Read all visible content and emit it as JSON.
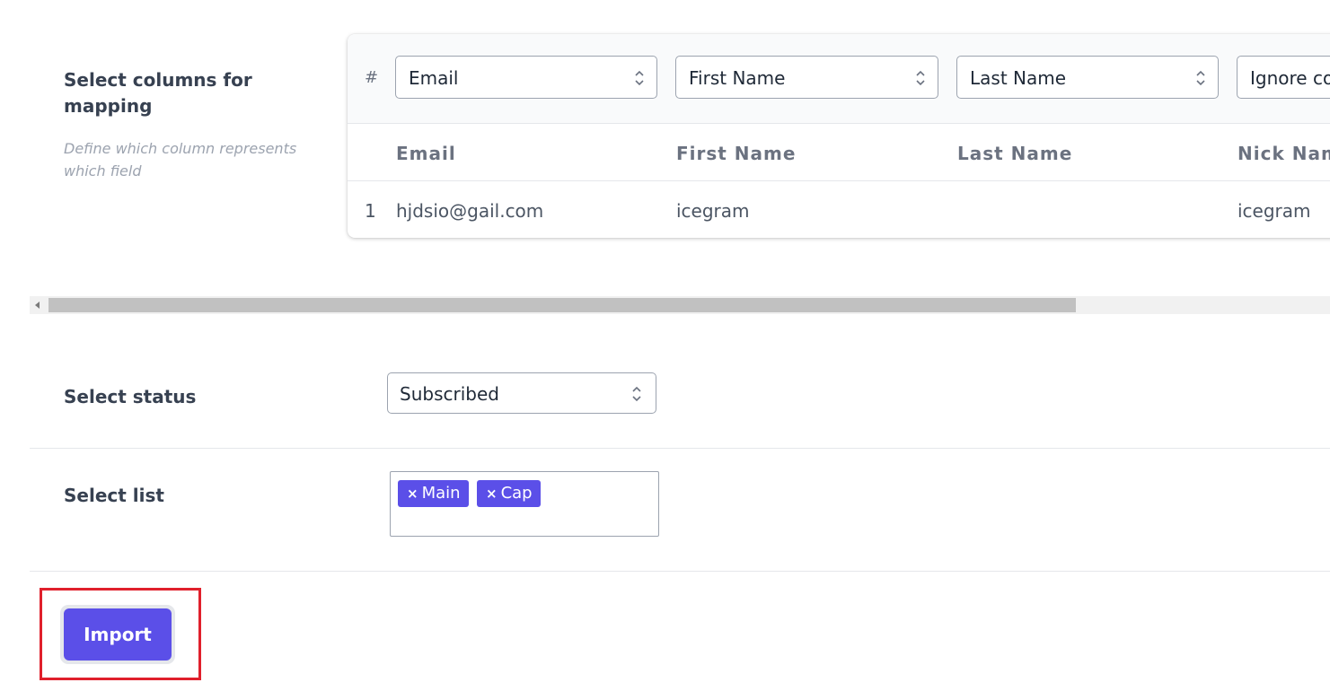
{
  "mapping": {
    "title": "Select columns for mapping",
    "description": "Define which column represents which field",
    "hash_symbol": "#",
    "column_selects": [
      "Email",
      "First Name",
      "Last Name",
      "Ignore co"
    ],
    "headers": [
      "Email",
      "First Name",
      "Last Name",
      "Nick Nam"
    ],
    "rows": [
      {
        "num": "1",
        "cells": [
          "hjdsio@gail.com",
          "icegram",
          "",
          "icegram"
        ]
      }
    ]
  },
  "status": {
    "label": "Select status",
    "selected": "Subscribed"
  },
  "lists": {
    "label": "Select list",
    "remove_symbol": "×",
    "tags": [
      "Main",
      "Cap"
    ]
  },
  "actions": {
    "import_label": "Import"
  },
  "colors": {
    "accent": "#5b4fe8",
    "highlight": "#e0202c"
  }
}
